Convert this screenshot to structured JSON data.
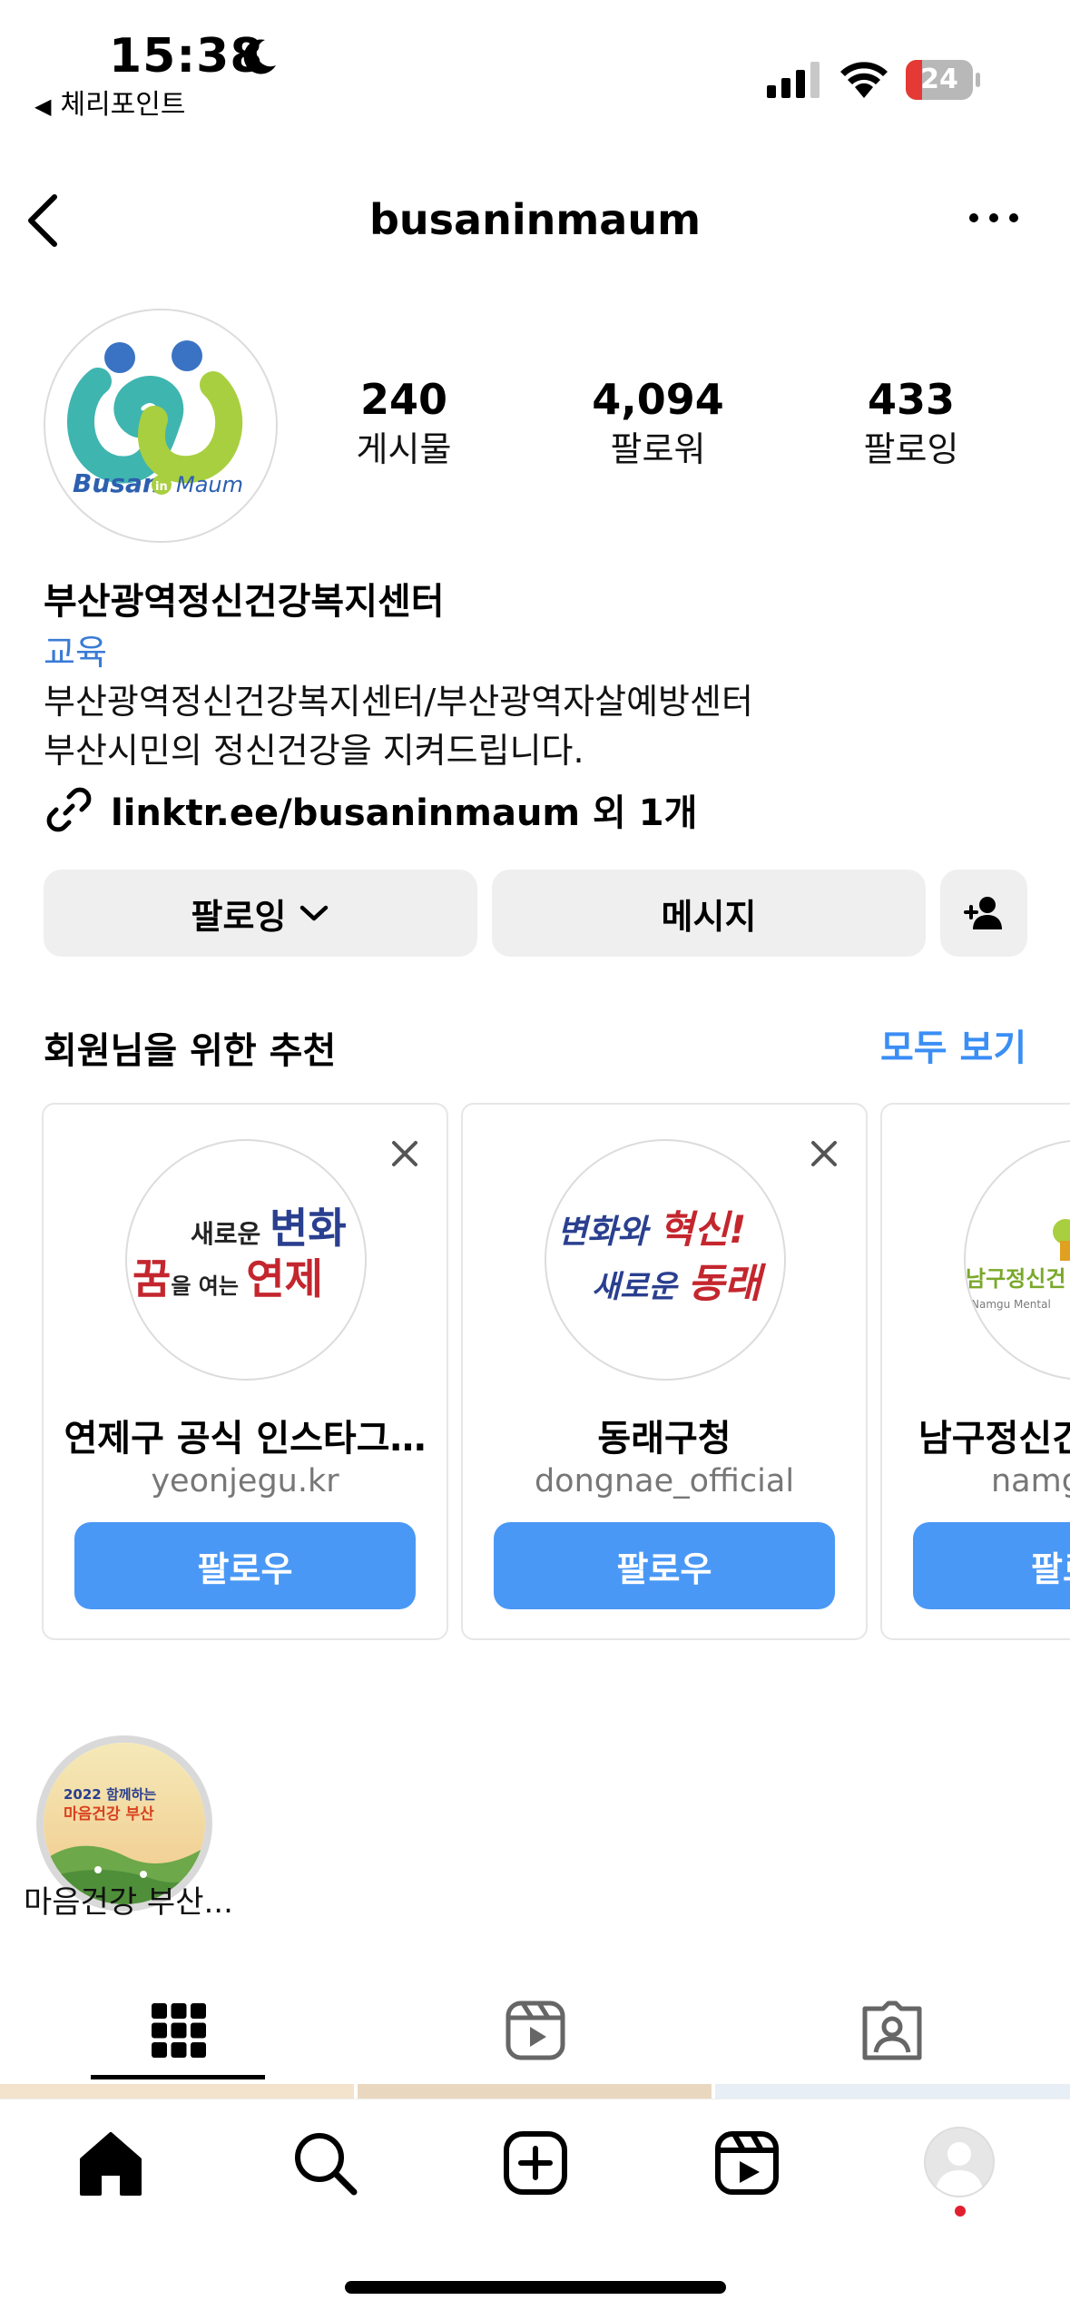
{
  "status_bar": {
    "time": "15:38",
    "back_app": "체리포인트",
    "battery_level": "24",
    "battery_fraction": 0.24
  },
  "header": {
    "username": "busaninmaum"
  },
  "profile": {
    "avatar_text": "Busan in Maum",
    "stats": [
      {
        "value": "240",
        "label": "게시물"
      },
      {
        "value": "4,094",
        "label": "팔로워"
      },
      {
        "value": "433",
        "label": "팔로잉"
      }
    ],
    "name": "부산광역정신건강복지센터",
    "category": "교육",
    "bio_lines": [
      "부산광역정신건강복지센터/부산광역자살예방센터",
      "부산시민의 정신건강을 지켜드립니다."
    ],
    "link": "linktr.ee/busaninmaum 외 1개"
  },
  "actions": {
    "following": "팔로잉",
    "message": "메시지"
  },
  "suggestions": {
    "title": "회원님을 위한 추천",
    "see_all": "모두 보기",
    "cards": [
      {
        "name": "연제구 공식 인스타그…",
        "username": "yeonjegu.kr",
        "button": "팔로우",
        "avatar_line1a": "새로운 ",
        "avatar_line1b": "변화",
        "avatar_line2a": "꿈",
        "avatar_line2b": "을 여는 ",
        "avatar_line2c": "연제"
      },
      {
        "name": "동래구청",
        "username": "dongnae_official",
        "button": "팔로우",
        "avatar_line1a": "변화와 ",
        "avatar_line1b": "혁신!",
        "avatar_line2a": "새로운 ",
        "avatar_line2b": "동래"
      },
      {
        "name": "남구정신건",
        "username": "namg",
        "button": "팔로",
        "avatar_text": "남구정신건",
        "avatar_sub": "Namgu Mental"
      }
    ]
  },
  "highlights": [
    {
      "label": "마음건강 부산...",
      "cover_title": "2022 함께하는",
      "cover_sub": "마음건강 부산"
    }
  ],
  "tabs": [
    "grid-icon",
    "reels-icon",
    "tagged-icon"
  ],
  "nav": [
    "home-icon",
    "search-icon",
    "create-icon",
    "reels-icon",
    "profile-icon"
  ],
  "colors": {
    "accent": "#3a8ef6",
    "follow_button": "#4a98f5",
    "category": "#3a7bd5",
    "button_gray": "#efefef",
    "notification_dot": "#e0202e"
  }
}
